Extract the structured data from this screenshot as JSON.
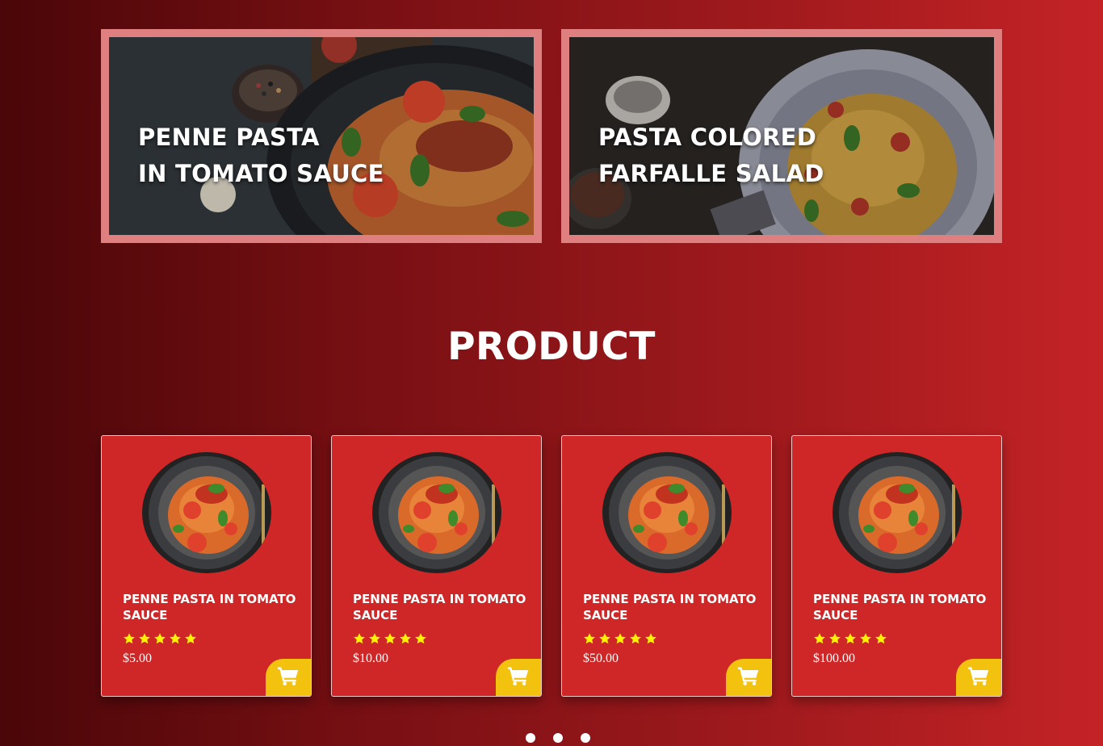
{
  "banners": [
    {
      "line1": "PENNE PASTA",
      "line2": "IN TOMATO SAUCE"
    },
    {
      "line1": "PASTA COLORED",
      "line2": "FARFALLE SALAD"
    }
  ],
  "section": {
    "title": "PRODUCT"
  },
  "products": [
    {
      "name": "PENNE PASTA IN TOMATO SAUCE",
      "rating": 5,
      "price": "$5.00"
    },
    {
      "name": "PENNE PASTA IN TOMATO SAUCE",
      "rating": 5,
      "price": "$10.00"
    },
    {
      "name": "PENNE PASTA IN TOMATO SAUCE",
      "rating": 5,
      "price": "$50.00"
    },
    {
      "name": "PENNE PASTA IN TOMATO SAUCE",
      "rating": 5,
      "price": "$100.00"
    }
  ],
  "icons": {
    "rating": "star-icon",
    "cart": "shopping-cart-icon"
  },
  "carousel": {
    "dot_count": 3
  },
  "colors": {
    "card_bg": "#cf2727",
    "star": "#fff200",
    "cart_button": "#f2c20e",
    "banner_border": "#e07f7f"
  }
}
